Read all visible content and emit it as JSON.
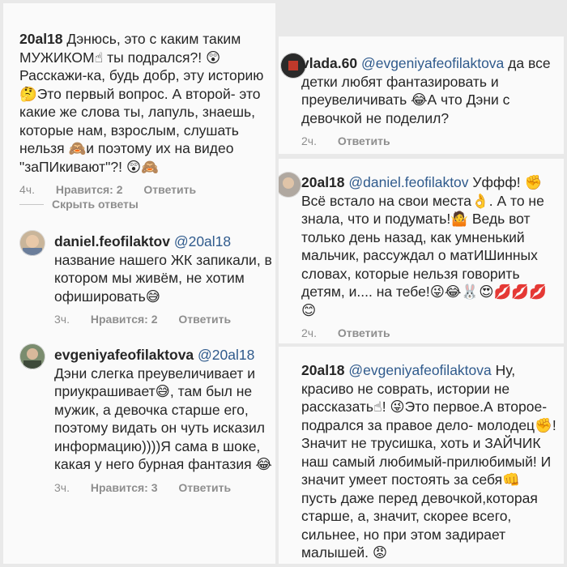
{
  "left": {
    "c1": {
      "user": "20al18",
      "text": " Дэнюсь, это с каким таким МУЖИКОМ☝ ты подрался?! 😲 Расскажи-ка, будь добр, эту историю 🤔Это первый вопрос. А второй- это какие же слова ты, лапуль, знаешь, которые нам, взрослым, слушать нельзя 🙈и поэтому их на видео \"заПИкивают\"?! 😲🙈",
      "time": "4ч.",
      "likes": "Нравится: 2",
      "reply": "Ответить"
    },
    "hide_replies": "Скрыть ответы",
    "c2": {
      "user": "daniel.feofilaktov",
      "mention": "@20al18",
      "text": " название нашего ЖК запикали, в котором мы живём, не хотим офишировать😅",
      "time": "3ч.",
      "likes": "Нравится: 2",
      "reply": "Ответить"
    },
    "c3": {
      "user": "evgeniyafeofilaktova",
      "mention": "@20al18",
      "text": " Дэни слегка преувеличивает и приукрашивает😅, там был не мужик, а девочка старше его, поэтому видать он чуть исказил информацию))))Я сама в шоке, какая у него бурная фантазия 😂",
      "time": "3ч.",
      "likes": "Нравится: 3",
      "reply": "Ответить"
    }
  },
  "right": {
    "c4": {
      "user": "vlada.60",
      "mention": "@evgeniyafeofilaktova",
      "text": " да все детки любят фантазировать и преувеличивать 😂А что Дэни с девочкой не поделил?",
      "time": "2ч.",
      "reply": "Ответить"
    },
    "c5": {
      "user": "20al18",
      "mention": "@daniel.feofilaktov",
      "text": " Уффф! ✊Всё встало на свои места👌. А то не знала, что и подумать!🤷 Ведь вот только день назад,  как умненький мальчик, рассуждал о матИШинных  словах, которые нельзя говорить детям, и.... на тебе!😜😂🐰😍💋💋💋😊",
      "time": "2ч.",
      "reply": "Ответить"
    },
    "c6": {
      "user": "20al18",
      "mention": "@evgeniyafeofilaktova",
      "text": " Ну, красиво не соврать, истории не рассказать☝! 😜Это первое.А второе-подрался за правое дело- молодец✊!Значит не трусишка, хоть и ЗАЙЧИК наш самый любимый-прилюбимый! И значит умеет постоять за себя👊 пусть даже перед девочкой,которая старше, а, значит, скорее всего, сильнее, но при этом задирает малышей. 😡"
    }
  }
}
